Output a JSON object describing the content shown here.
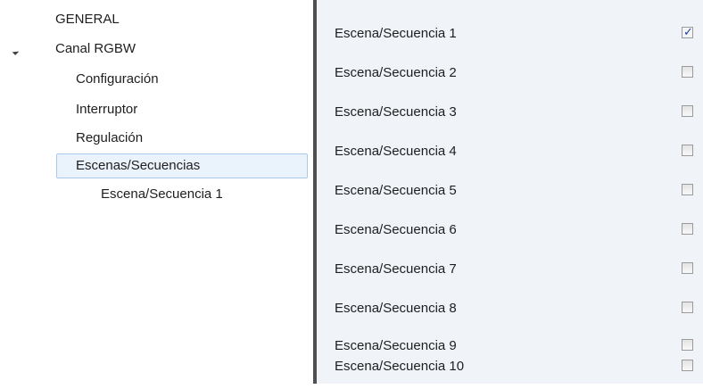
{
  "tree": {
    "items": [
      {
        "label": "GENERAL"
      },
      {
        "label": "Canal RGBW"
      },
      {
        "label": "Configuración"
      },
      {
        "label": "Interruptor"
      },
      {
        "label": "Regulación"
      },
      {
        "label": "Escenas/Secuencias"
      },
      {
        "label": "Escena/Secuencia 1"
      }
    ],
    "selected_item": "Escenas/Secuencias",
    "expanded_item": "Canal RGBW"
  },
  "scenes": {
    "rows": [
      {
        "label": "Escena/Secuencia 1",
        "checked": true
      },
      {
        "label": "Escena/Secuencia 2",
        "checked": false
      },
      {
        "label": "Escena/Secuencia 3",
        "checked": false
      },
      {
        "label": "Escena/Secuencia 4",
        "checked": false
      },
      {
        "label": "Escena/Secuencia 5",
        "checked": false
      },
      {
        "label": "Escena/Secuencia 6",
        "checked": false
      },
      {
        "label": "Escena/Secuencia 7",
        "checked": false
      },
      {
        "label": "Escena/Secuencia 8",
        "checked": false
      },
      {
        "label": "Escena/Secuencia 9",
        "checked": false
      },
      {
        "label": "Escena/Secuencia 10",
        "checked": false
      }
    ]
  },
  "colors": {
    "selection_fill": "#eaf2fb",
    "selection_border": "#a8c8ec",
    "panel_background": "#f0f4f9",
    "splitter": "#4f4f4f",
    "checkmark": "#1f3f9f"
  },
  "icons": {
    "expander": "expanded-triangle-icon",
    "checkbox_mark": "checkmark-icon"
  }
}
